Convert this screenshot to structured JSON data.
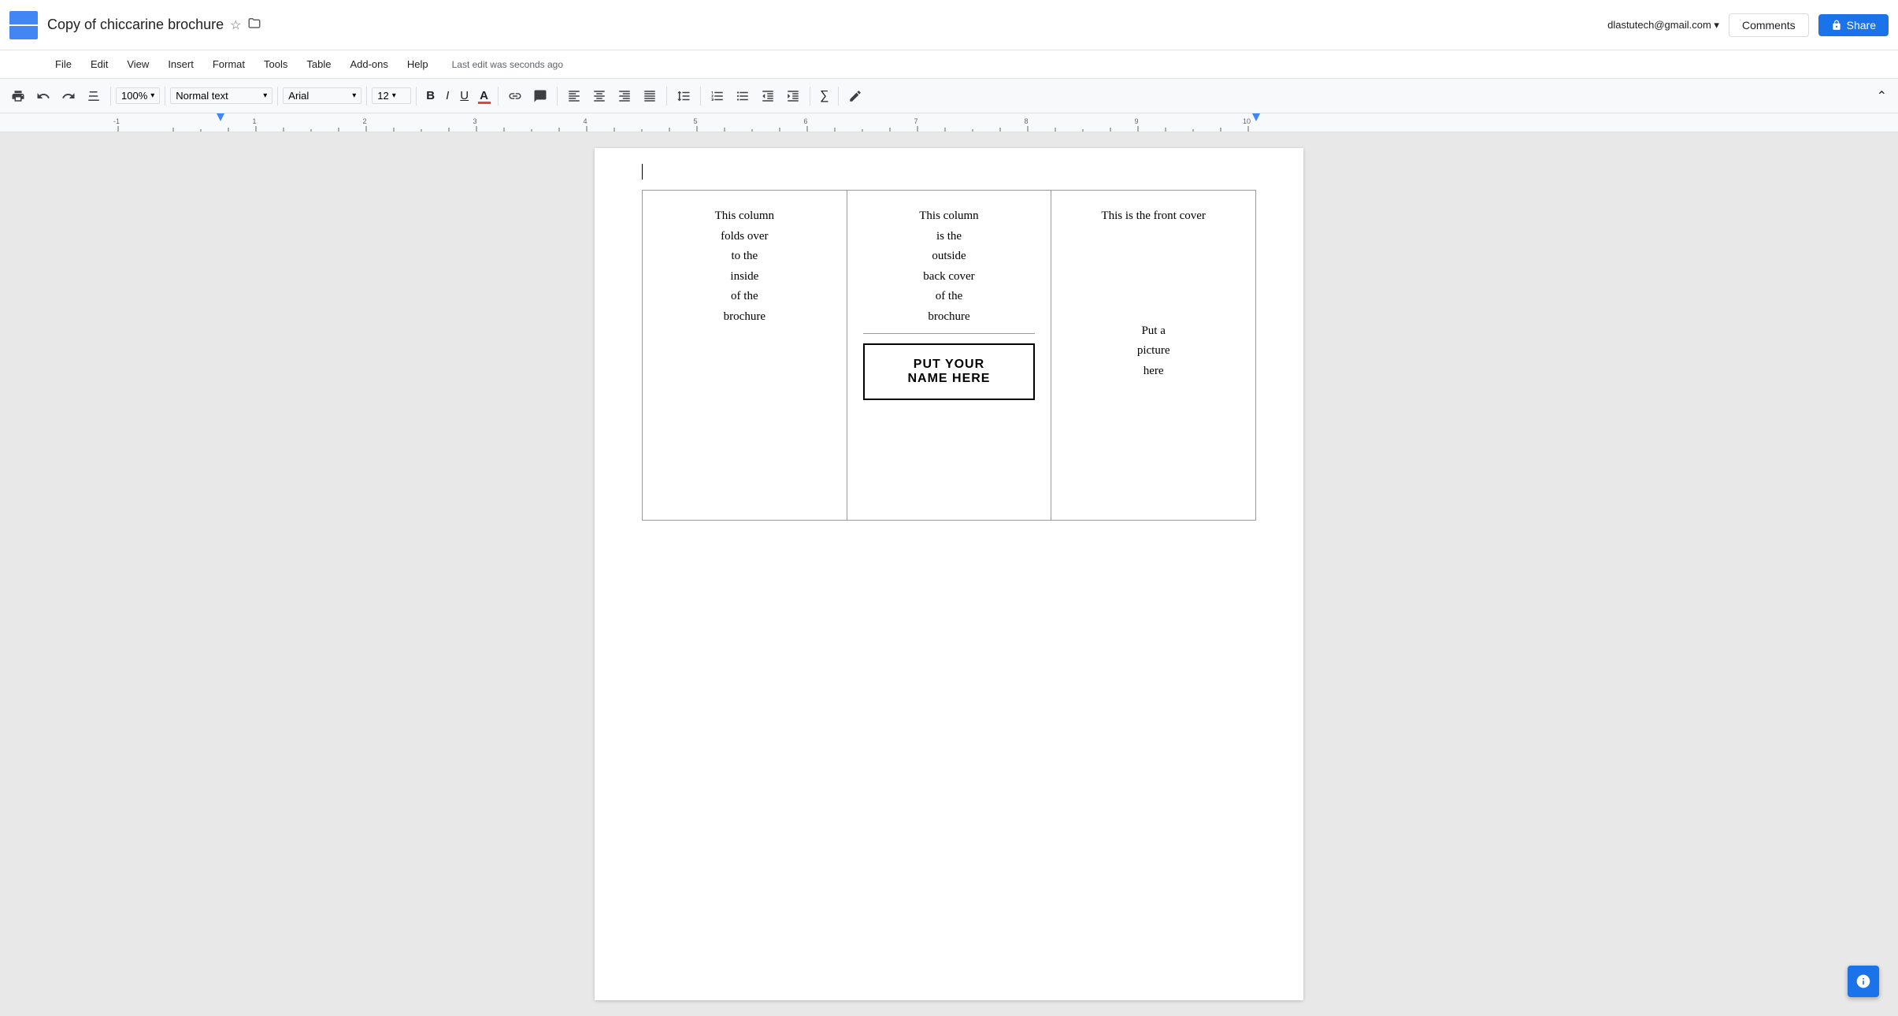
{
  "app": {
    "menu_icon_label": "☰"
  },
  "header": {
    "title": "Copy of chiccarine brochure",
    "star_icon": "☆",
    "folder_icon": "▭",
    "user_email": "dlastutech@gmail.com",
    "dropdown_icon": "▾",
    "comments_label": "Comments",
    "share_label": "Share",
    "share_icon": "🔒"
  },
  "menubar": {
    "items": [
      "File",
      "Edit",
      "View",
      "Insert",
      "Format",
      "Tools",
      "Table",
      "Add-ons",
      "Help"
    ],
    "last_edit": "Last edit was seconds ago"
  },
  "toolbar": {
    "print_icon": "⎙",
    "undo_icon": "↩",
    "redo_icon": "↪",
    "paint_icon": "🖌",
    "zoom_value": "100%",
    "zoom_arrow": "▾",
    "style_value": "Normal text",
    "style_arrow": "▾",
    "font_value": "Arial",
    "font_arrow": "▾",
    "fontsize_value": "12",
    "fontsize_arrow": "▾",
    "bold_label": "B",
    "italic_label": "I",
    "underline_label": "U",
    "color_label": "A",
    "link_icon": "🔗",
    "comment_icon": "💬",
    "align_left": "≡",
    "align_center": "≡",
    "align_right": "≡",
    "align_justify": "≡",
    "line_spacing": "↕",
    "num_list": "≔",
    "bullet_list": "≔",
    "indent_less": "⇤",
    "indent_more": "⇥",
    "formula_icon": "∑",
    "pen_icon": "✏",
    "chevron_up": "⌃"
  },
  "document": {
    "brochure": {
      "col1": {
        "text": "This column\nfolds over\nto the\ninside\nof the\nbrochure"
      },
      "col2": {
        "upper_text": "This column\nis the\noutside\nback cover\nof the\nbrochure",
        "name_box": "PUT YOUR\nNAME HERE",
        "lower_text": ""
      },
      "col3": {
        "upper_text": "This is the front cover",
        "picture_text": "Put a\npicture\nhere"
      }
    }
  }
}
